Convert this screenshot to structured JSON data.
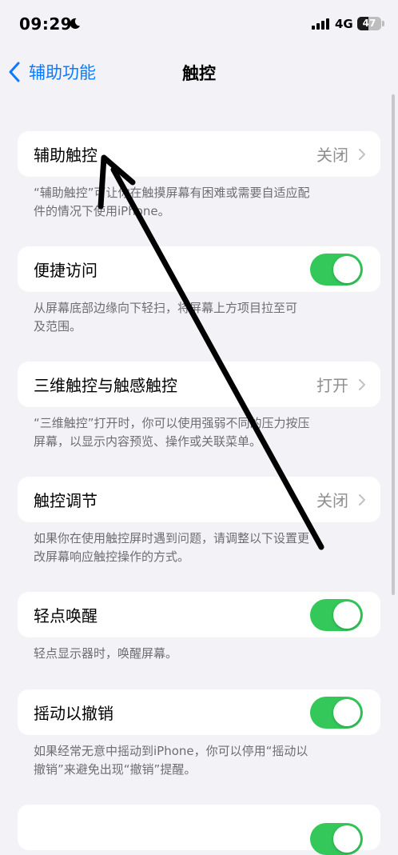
{
  "status_bar": {
    "time": "09:29",
    "network": "4G",
    "battery_level": "47",
    "icons": [
      "moon-icon",
      "signal-icon",
      "battery-icon"
    ]
  },
  "nav": {
    "back_label": "辅助功能",
    "title": "触控"
  },
  "rows": [
    {
      "label": "辅助触控",
      "value": "关闭",
      "type": "disclosure"
    },
    {
      "label": "便捷访问",
      "type": "toggle",
      "on": true
    },
    {
      "label": "三维触控与触感触控",
      "value": "打开",
      "type": "disclosure"
    },
    {
      "label": "触控调节",
      "value": "关闭",
      "type": "disclosure"
    },
    {
      "label": "轻点唤醒",
      "type": "toggle",
      "on": true
    },
    {
      "label": "摇动以撤销",
      "type": "toggle",
      "on": true
    },
    {
      "type": "toggle",
      "on": true
    }
  ],
  "footers": [
    [
      "“辅助触控”可让你在触摸屏幕有困难或需要自适应配",
      "件的情况下使用iPhone。"
    ],
    [
      "从屏幕底部边缘向下轻扫，将屏幕上方项目拉至可",
      "及范围。"
    ],
    [
      "“三维触控”打开时，你可以使用强弱不同的压力按压",
      "屏幕，以显示内容预览、操作或关联菜单。"
    ],
    [
      "如果你在使用触控屏时遇到问题，请调整以下设置更",
      "改屏幕响应触控操作的方式。"
    ],
    [
      "轻点显示器时，唤醒屏幕。"
    ],
    [
      "如果经常无意中摇动到iPhone，你可以停用“摇动以",
      "撤销”来避免出现“撤销”提醒。"
    ]
  ],
  "colors": {
    "accent": "#0a7cff",
    "toggle_on": "#34c759",
    "background": "#f2f2f7",
    "annotation": "#000000"
  }
}
